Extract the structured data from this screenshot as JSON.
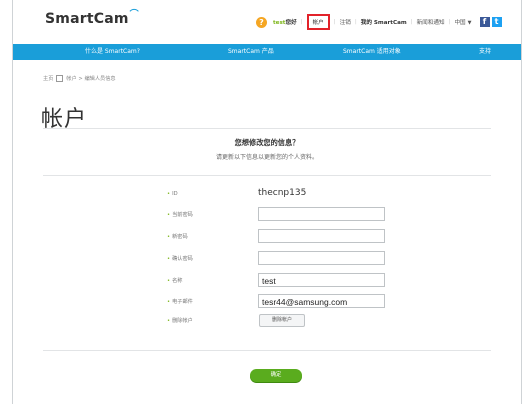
{
  "header": {
    "logo": "SmartCam",
    "help_icon_char": "?",
    "greeting_user": "test",
    "greeting_suffix": "您好",
    "links": {
      "account": "帐户",
      "logout": "注销",
      "my_smartcam": "我的 SmartCam",
      "notice": "新闻和通知",
      "region": "中国"
    },
    "social": {
      "facebook": "f",
      "twitter": "t"
    }
  },
  "nav": {
    "items": [
      "什么是 SmartCam?",
      "SmartCam 产品",
      "SmartCam 适用对象",
      "支持"
    ]
  },
  "breadcrumb": {
    "home": "主页",
    "account": "帐户",
    "current": "编辑人员信息"
  },
  "page": {
    "title": "帐户",
    "question": "您想修改您的信息？",
    "subtitle": "请更新以下信息以更新您的个人资料。"
  },
  "form": {
    "id_label": "ID",
    "id_value": "thecnp135",
    "current_pw_label": "当前密码",
    "current_pw_value": "",
    "new_pw_label": "新密码",
    "new_pw_value": "",
    "confirm_pw_label": "确认密码",
    "confirm_pw_value": "",
    "name_label": "名称",
    "name_value": "test",
    "email_label": "电子邮件",
    "email_value": "tesr44@samsung.com",
    "delete_label": "删除帐户",
    "delete_button": "删除帐户"
  },
  "confirm_button": "确定",
  "colors": {
    "nav_blue": "#1a9ed9",
    "accent_green": "#5aac1e",
    "highlight_red": "#e2222a"
  }
}
